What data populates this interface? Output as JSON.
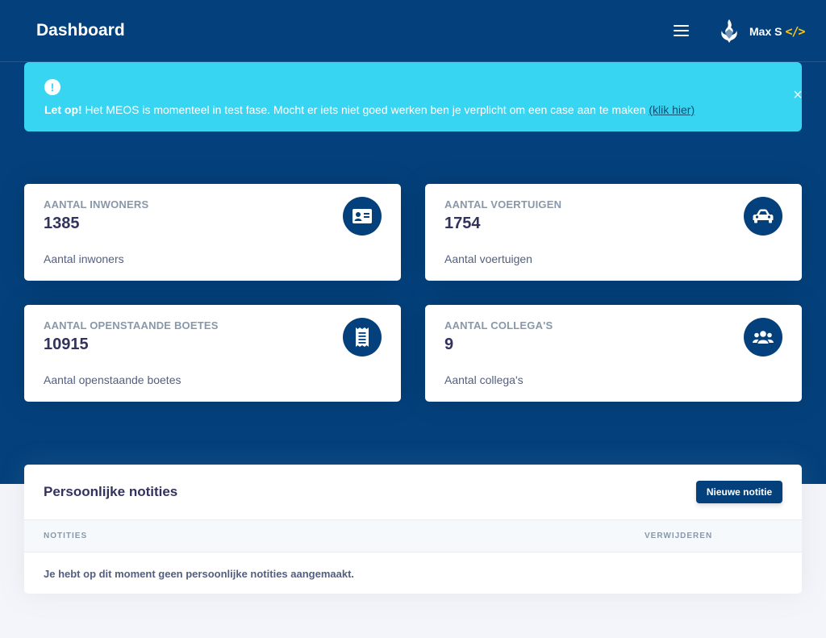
{
  "header": {
    "title": "Dashboard",
    "user_name": "Max S",
    "user_badge": "</>"
  },
  "alert": {
    "icon": "!",
    "bold": "Let op!",
    "message": " Het MEOS is momenteel in test fase. Mocht er iets niet goed werken ben je verplicht om een case aan te maken ",
    "link": "(klik hier)",
    "close": "×"
  },
  "stats": [
    {
      "title": "AANTAL INWONERS",
      "value": "1385",
      "sub": "Aantal inwoners",
      "icon": "id-card-icon"
    },
    {
      "title": "AANTAL VOERTUIGEN",
      "value": "1754",
      "sub": "Aantal voertuigen",
      "icon": "car-icon"
    },
    {
      "title": "AANTAL OPENSTAANDE BOETES",
      "value": "10915",
      "sub": "Aantal openstaande boetes",
      "icon": "receipt-icon"
    },
    {
      "title": "AANTAL COLLEGA'S",
      "value": "9",
      "sub": "Aantal collega's",
      "icon": "users-icon"
    }
  ],
  "notes": {
    "title": "Persoonlijke notities",
    "new_button": "Nieuwe notitie",
    "columns": [
      "NOTITIES",
      "VERWIJDEREN"
    ],
    "empty": "Je hebt op dit moment geen persoonlijke notities aangemaakt."
  },
  "colors": {
    "primary": "#04417c",
    "alert": "#37d5f2",
    "accent": "#f7c815"
  }
}
